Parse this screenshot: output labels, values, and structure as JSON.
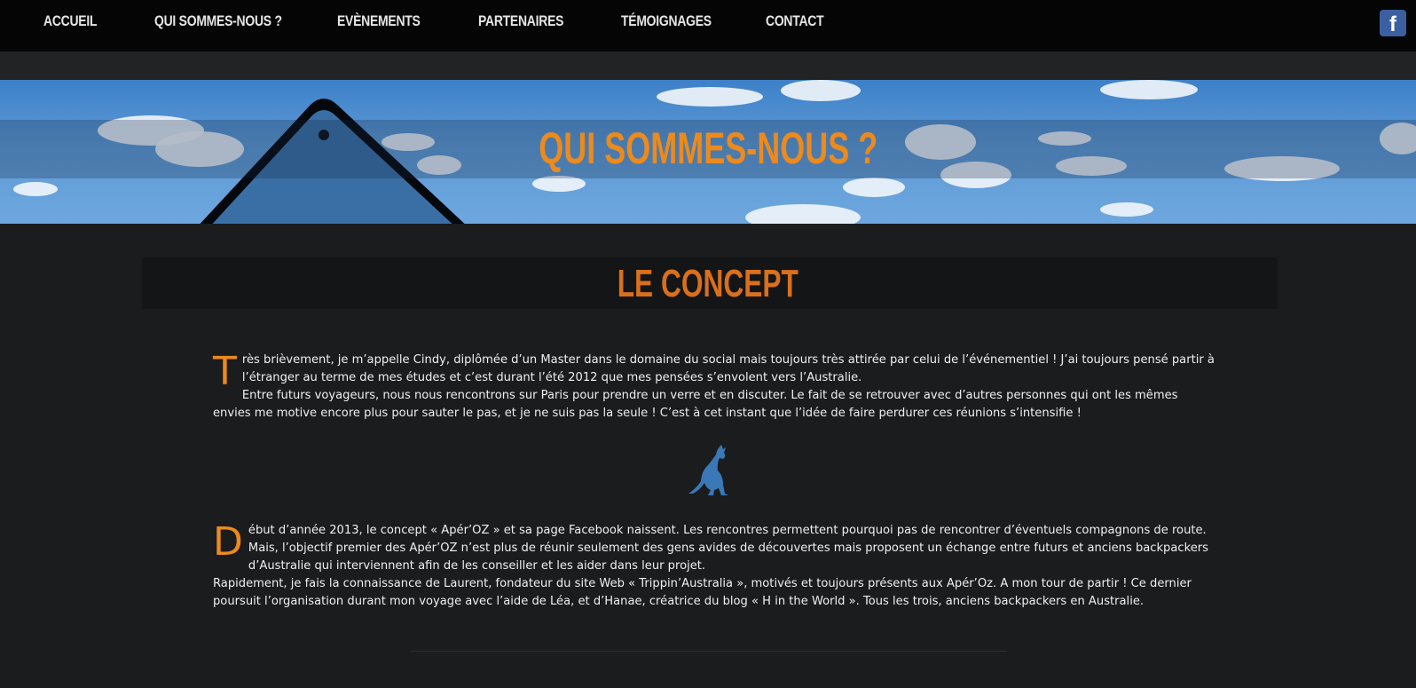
{
  "nav": {
    "items": [
      {
        "label": "ACCUEIL"
      },
      {
        "label": "QUI SOMMES-NOUS ?"
      },
      {
        "label": "EVÈNEMENTS"
      },
      {
        "label": "PARTENAIRES"
      },
      {
        "label": "TÉMOIGNAGES"
      },
      {
        "label": "CONTACT"
      }
    ],
    "facebook_glyph": "f",
    "facebook_icon": "facebook-icon"
  },
  "banner": {
    "title": "QUI SOMMES-NOUS ?"
  },
  "section": {
    "title": "LE CONCEPT"
  },
  "paragraphs": [
    {
      "dropcap": "T",
      "text": "rès brièvement, je m’appelle Cindy, diplômée d’un Master dans le domaine du social mais toujours très attirée par celui de l’événementiel ! J’ai toujours pensé partir à l’étranger au terme de mes études et c’est durant l’été 2012 que mes pensées s’envolent vers l’Australie.",
      "text2": "Entre futurs voyageurs, nous nous rencontrons sur Paris pour prendre un verre et en discuter. Le fait de se retrouver avec d’autres personnes qui ont les mêmes envies me motive encore plus pour sauter le pas, et je ne suis pas la seule ! C’est à cet instant que l’idée de faire perdurer ces réunions s’intensifie !"
    },
    {
      "dropcap": "D",
      "text": "ébut d’année 2013, le concept « Apér’OZ » et sa page Facebook naissent. Les rencontres permettent pourquoi pas de rencontrer d’éventuels compagnons de route. Mais, l’objectif premier des Apér’OZ n’est plus de réunir seulement des gens avides de découvertes mais proposent un échange entre futurs et anciens backpackers d’Australie qui interviennent afin de les conseiller et les aider dans leur projet.",
      "text2": "Rapidement, je fais la connaissance de Laurent, fondateur du site Web « Trippin’Australia », motivés et toujours présents aux Apér’Oz. A mon tour de partir ! Ce dernier poursuit l’organisation durant mon voyage avec l’aide de Léa, et d’Hanae, créatrice du blog « H in the World ». Tous les trois, anciens backpackers en Australie."
    }
  ],
  "colors": {
    "accent_orange": "#ec8a1d",
    "nav_bg": "#050505",
    "page_bg": "#1b1c1d",
    "kangaroo_blue": "#3a78b8"
  },
  "icons": {
    "divider_icon": "kangaroo-icon"
  }
}
